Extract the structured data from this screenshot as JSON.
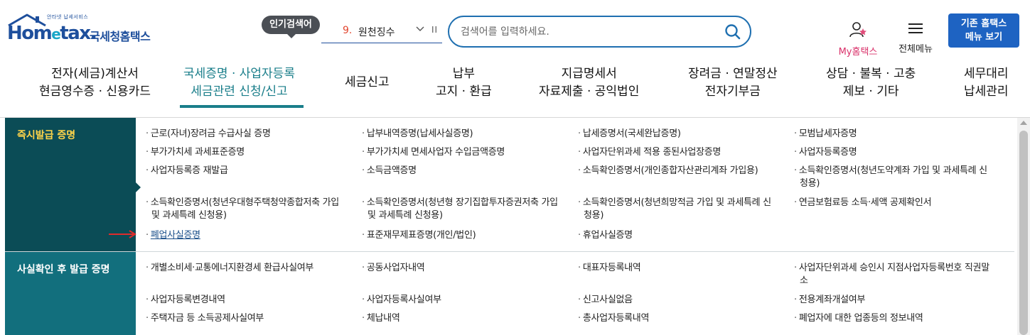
{
  "header": {
    "logo_text": "Hometax",
    "logo_sub": "안타넷 납세서비스",
    "logo_korean": "국세청홈택스",
    "popular_label": "인기검색어",
    "rank": {
      "number": "9.",
      "text": "원천징수",
      "pause_label": "II"
    },
    "search": {
      "placeholder": "검색어를 입력하세요.",
      "value": ""
    },
    "my_label": "My홈택스",
    "allmenu_label": "전체메뉴",
    "classic_line1": "기존 홈택스",
    "classic_line2": "메뉴 보기"
  },
  "nav": {
    "items": [
      {
        "line1": "전자(세금)계산서",
        "line2": "현금영수증 · 신용카드"
      },
      {
        "line1": "국세증명 · 사업자등록",
        "line2": "세금관련 신청/신고"
      },
      {
        "line1": "세금신고",
        "line2": ""
      },
      {
        "line1": "납부",
        "line2": "고지 · 환급"
      },
      {
        "line1": "지급명세서",
        "line2": "자료제출 · 공익법인"
      },
      {
        "line1": "장려금 · 연말정산",
        "line2": "전자기부금"
      },
      {
        "line1": "상담 · 불복 · 고충",
        "line2": "제보 · 기타"
      },
      {
        "line1": "세무대리",
        "line2": "납세관리"
      }
    ]
  },
  "categories": [
    {
      "label": "즉시발급 증명",
      "items": [
        {
          "l1": "근로(자녀)장려금 수급사실 증명",
          "l2": ""
        },
        {
          "l1": "납부내역증명(납세사실증명)",
          "l2": ""
        },
        {
          "l1": "납세증명서(국세완납증명)",
          "l2": ""
        },
        {
          "l1": "모범납세자증명",
          "l2": ""
        },
        {
          "l1": "부가가치세 과세표준증명",
          "l2": ""
        },
        {
          "l1": "부가가치세 면세사업자 수입금액증명",
          "l2": ""
        },
        {
          "l1": "사업자단위과세 적용 종된사업장증명",
          "l2": ""
        },
        {
          "l1": "사업자등록증명",
          "l2": ""
        },
        {
          "l1": "사업자등록증 재발급",
          "l2": ""
        },
        {
          "l1": "소득금액증명",
          "l2": ""
        },
        {
          "l1": "소득확인증명서(개인종합자산관리계좌 가입용)",
          "l2": ""
        },
        {
          "l1": "소득확인증명서(청년도약계좌 가입 및 과세특례 신",
          "l2": "청용)"
        },
        {
          "l1": "소득확인증명서(청년우대형주택청약종합저축 가입",
          "l2": "및 과세특례 신청용)"
        },
        {
          "l1": "소득확인증명서(청년형 장기집합투자증권저축 가입",
          "l2": "및 과세특례 신청용)"
        },
        {
          "l1": "소득확인증명서(청년희망적금 가입 및 과세특례 신",
          "l2": "청용)"
        },
        {
          "l1": "연금보험료등 소득·세액 공제확인서",
          "l2": ""
        },
        {
          "l1": "폐업사실증명",
          "l2": ""
        },
        {
          "l1": "표준재무제표증명(개인/법인)",
          "l2": ""
        },
        {
          "l1": "휴업사실증명",
          "l2": ""
        }
      ]
    },
    {
      "label": "사실확인 후 발급 증명",
      "items": [
        {
          "l1": "개별소비세·교통에너지환경세 환급사실여부",
          "l2": ""
        },
        {
          "l1": "공동사업자내역",
          "l2": ""
        },
        {
          "l1": "대표자등록내역",
          "l2": ""
        },
        {
          "l1": "사업자단위과세 승인시 지점사업자등록번호 직권말",
          "l2": "소"
        },
        {
          "l1": "사업자등록변경내역",
          "l2": ""
        },
        {
          "l1": "사업자등록사실여부",
          "l2": ""
        },
        {
          "l1": "신고사실없음",
          "l2": ""
        },
        {
          "l1": "전용계좌개설여부",
          "l2": ""
        },
        {
          "l1": "주택자금 등 소득공제사실여부",
          "l2": ""
        },
        {
          "l1": "체납내역",
          "l2": ""
        },
        {
          "l1": "총사업자등록내역",
          "l2": ""
        },
        {
          "l1": "폐업자에 대한 업종등의 정보내역",
          "l2": ""
        }
      ]
    }
  ],
  "colors": {
    "brand_blue": "#1e4f9c",
    "accent_teal": "#1a7e8a",
    "category_dark": "#0b4c56",
    "category_mid": "#126f7d",
    "category_label_yellow": "#ffd44a",
    "rank_red": "#e2462f",
    "my_pink": "#d9316a",
    "arrow_red": "#e02b2b"
  },
  "icons": {
    "search": "search-icon",
    "my": "user-star-icon",
    "allmenu": "hamburger-icon",
    "rank_toggle": "chevron-down-icon",
    "pointer": "red-arrow-icon"
  }
}
